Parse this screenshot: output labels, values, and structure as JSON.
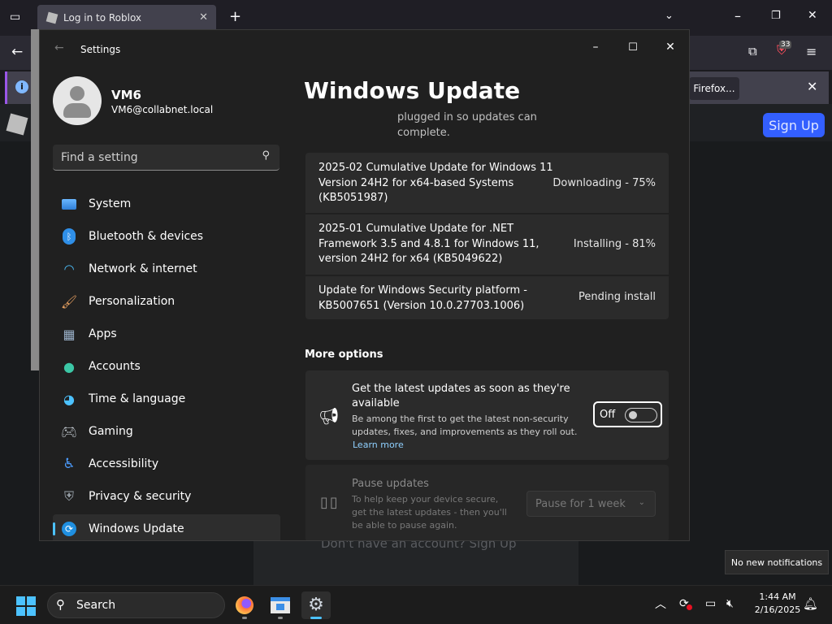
{
  "browser": {
    "tab_title": "Log in to Roblox",
    "extension_badge": "33",
    "firefox_button": "Firefox...",
    "signup_button": "Sign Up",
    "dont_have_account": "Don't have an account? Sign Up"
  },
  "settings": {
    "window_title": "Settings",
    "profile": {
      "name": "VM6",
      "email": "VM6@collabnet.local"
    },
    "search_placeholder": "Find a setting",
    "nav": [
      {
        "label": "System",
        "icon": "monitor-icon"
      },
      {
        "label": "Bluetooth & devices",
        "icon": "bluetooth-icon"
      },
      {
        "label": "Network & internet",
        "icon": "wifi-icon"
      },
      {
        "label": "Personalization",
        "icon": "brush-icon"
      },
      {
        "label": "Apps",
        "icon": "apps-icon"
      },
      {
        "label": "Accounts",
        "icon": "person-icon"
      },
      {
        "label": "Time & language",
        "icon": "globe-clock-icon"
      },
      {
        "label": "Gaming",
        "icon": "gamepad-icon"
      },
      {
        "label": "Accessibility",
        "icon": "accessibility-icon"
      },
      {
        "label": "Privacy & security",
        "icon": "shield-icon"
      },
      {
        "label": "Windows Update",
        "icon": "update-icon",
        "active": true
      }
    ],
    "page_title": "Windows Update",
    "partial_text": "plugged in so updates can complete.",
    "updates": [
      {
        "name": "2025-02 Cumulative Update for Windows 11 Version 24H2 for x64-based Systems (KB5051987)",
        "status": "Downloading - 75%"
      },
      {
        "name": "2025-01 Cumulative Update for .NET Framework 3.5 and 4.8.1 for Windows 11, version 24H2 for x64 (KB5049622)",
        "status": "Installing - 81%"
      },
      {
        "name": "Update for Windows Security platform - KB5007651 (Version 10.0.27703.1006)",
        "status": "Pending install"
      }
    ],
    "more_options_title": "More options",
    "latest_updates": {
      "title": "Get the latest updates as soon as they're available",
      "description": "Be among the first to get the latest non-security updates, fixes, and improvements as they roll out.",
      "link": "Learn more",
      "toggle_label": "Off",
      "toggle_on": false
    },
    "pause_updates": {
      "title": "Pause updates",
      "description": "To help keep your device secure, get the latest updates - then you'll be able to pause again.",
      "select_value": "Pause for 1 week"
    }
  },
  "notification_toast": "No new notifications",
  "taskbar": {
    "search_label": "Search",
    "time": "1:44 AM",
    "date": "2/16/2025"
  },
  "colors": {
    "accent": "#4cc2ff",
    "settings_bg": "#202020",
    "card_bg": "#2b2b2b"
  }
}
